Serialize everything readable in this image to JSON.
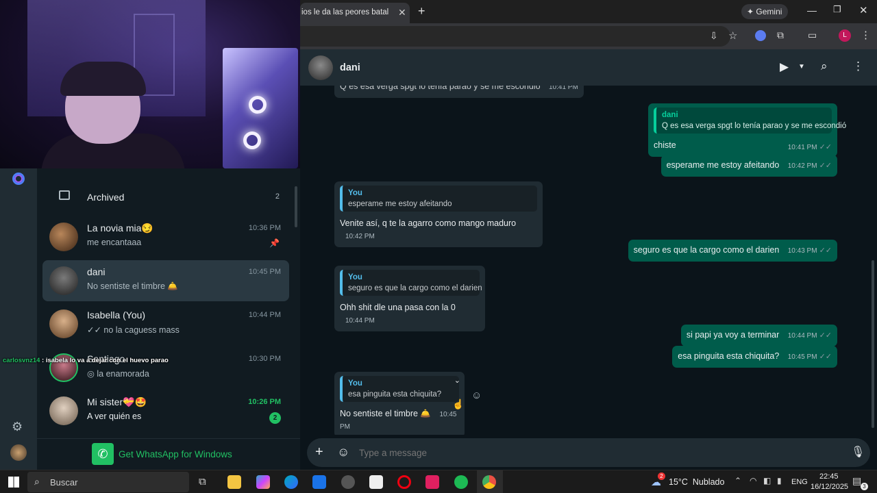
{
  "browser": {
    "tab_title": "ios le da las peores batallas a",
    "gemini_label": "Gemini",
    "profile_initial": "L"
  },
  "stream_overlay": {
    "chat_user": "carlosvnz14",
    "chat_text": " : isabela lo va a dejar con el huevo parao"
  },
  "sidebar": {
    "archived_label": "Archived",
    "archived_count": "2",
    "chats": [
      {
        "name": "La novia mia😏",
        "msg": "me encantaaa",
        "time": "10:36 PM",
        "pinned": true
      },
      {
        "name": "dani",
        "msg": "No sentiste el timbre 🛎️",
        "time": "10:45 PM"
      },
      {
        "name": "Isabella (You)",
        "msg": "✓✓ no la caguess mass",
        "time": "10:44 PM"
      },
      {
        "name": "Santiago",
        "msg": "◎ la enamorada",
        "time": "10:30 PM"
      },
      {
        "name": "Mi sister💝🤩",
        "msg": "A ver quién es",
        "time": "10:26 PM",
        "unread": "2"
      }
    ],
    "promo_label": "Get WhatsApp for Windows"
  },
  "chat": {
    "contact_name": "dani",
    "top_partial": "Q es esa verga spgt lo tenía parao y se me escondió",
    "top_partial_time": "10:41 PM",
    "messages": [
      {
        "dir": "out",
        "quote_name": "dani",
        "quote_text": "Q es esa verga spgt lo tenía parao y se me escondió",
        "text": "chiste",
        "time": "10:41 PM"
      },
      {
        "dir": "out",
        "text": "esperame me estoy afeitando",
        "time": "10:42 PM"
      },
      {
        "dir": "in",
        "quote_name": "You",
        "quote_text": "esperame me estoy afeitando",
        "text": "Venite así, q te la agarro como mango maduro",
        "time": "10:42 PM"
      },
      {
        "dir": "out",
        "text": "seguro es que la cargo como el darien",
        "time": "10:43 PM"
      },
      {
        "dir": "in",
        "quote_name": "You",
        "quote_text": "seguro es que la cargo como el darien",
        "text": "Ohh shit dle una pasa con la 0",
        "time": "10:44 PM"
      },
      {
        "dir": "out",
        "text": "si papi ya voy a terminar",
        "time": "10:44 PM"
      },
      {
        "dir": "out",
        "text": "esa pinguita esta chiquita?",
        "time": "10:45 PM"
      },
      {
        "dir": "in",
        "quote_name": "You",
        "quote_text": "esa pinguita esta chiquita?",
        "text": "No sentiste el timbre 🛎️",
        "time": "10:45 PM"
      }
    ],
    "input_placeholder": "Type a message"
  },
  "taskbar": {
    "search_label": "Buscar",
    "weather": "15°C  Nublado",
    "weather_badge": "2",
    "lang": "ENG",
    "time": "22:45",
    "date": "16/12/2025",
    "notif_count": "3"
  },
  "colors": {
    "accent": "#21c063",
    "bubble_out": "#005c4b",
    "bubble_in": "#202c33",
    "quote_bar": "#53bdeb"
  }
}
